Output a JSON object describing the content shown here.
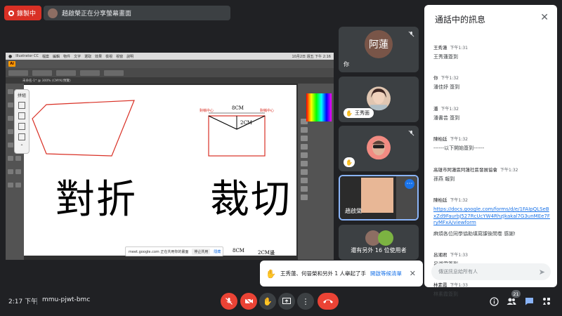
{
  "recording": {
    "label": "錄製中"
  },
  "share_bar": {
    "label": "趙啟榮正在分享螢幕畫面"
  },
  "presentation": {
    "menubar": [
      "Illustrator CC",
      "檔案",
      "編輯",
      "物件",
      "文字",
      "選取",
      "效果",
      "檢視",
      "視窗",
      "說明"
    ],
    "menubar_right": "10月2日 週五 下午 2:16",
    "doc_tab": "未命名-1* @ 300% (CMYK/預覽)",
    "canvas": {
      "text_left": "對折",
      "text_right": "裁切",
      "label_8cm_top": "8CM",
      "label_8cm_bottom": "8CM",
      "label_2cm": "2CM",
      "label_2cm_bottom": "2CM邊",
      "red_left": "對稱中心",
      "red_right": "對稱中心"
    },
    "popup_tools_label": "拼組",
    "share_notice": {
      "text": "meet.google.com 正在共用你的畫面",
      "stop": "停止共用",
      "hide": "隱藏"
    }
  },
  "participants": [
    {
      "name": "你",
      "avatar_text": "阿蓮",
      "muted": true
    },
    {
      "name": "王秀面",
      "hand_raised": true,
      "muted": false
    },
    {
      "name": "",
      "hand_raised": true,
      "muted": true
    },
    {
      "name": "趙啟榮",
      "presenting": true
    },
    {
      "label": "還有另外 16 位使用者"
    }
  ],
  "chat": {
    "title": "通話中的訊息",
    "messages": [
      {
        "sender": "王秀蓮",
        "time": "下午1:31",
        "text": "王秀蓮簽到"
      },
      {
        "sender": "你",
        "time": "下午1:32",
        "text": "潘佳妤 簽到"
      },
      {
        "sender": "潘",
        "time": "下午1:32",
        "text": "潘書芸 簽到"
      },
      {
        "sender": "陳柏廷",
        "time": "下午1:32",
        "text": "------以下開始簽到------"
      },
      {
        "sender": "高雄市阿蓮區阿蓮社區發展協會",
        "time": "下午1:32",
        "text": "孫燕 報到"
      },
      {
        "sender": "陳柏廷",
        "time": "下午1:32",
        "text": "https://docs.google.com/forms/d/e/1FAIpQLSeBxZd9FaurbJ527RcUcYW4RhzJkakal7G3unMEe7FryMFxA/viewform",
        "is_link": true
      },
      {
        "sender": "",
        "time": "",
        "text": "麻煩各位同學協助填寫課後問卷 感謝!"
      },
      {
        "sender": "呂湘君",
        "time": "下午1:33",
        "text": "呂湘君簽到"
      },
      {
        "sender": "林素霞",
        "time": "下午1:33",
        "text": "林素霞簽到"
      }
    ],
    "input_placeholder": "傳送訊息給所有人"
  },
  "toast": {
    "text": "王秀蓮、何晉榮和另外 1 人舉起了手",
    "action": "開啟等候清單"
  },
  "bottom": {
    "time": "2:17 下午",
    "meeting_code": "mmu-pjwt-bmc",
    "people_count": "21"
  },
  "colors": {
    "accent": "#1a73e8",
    "danger": "#ea4335",
    "background": "#202124"
  }
}
